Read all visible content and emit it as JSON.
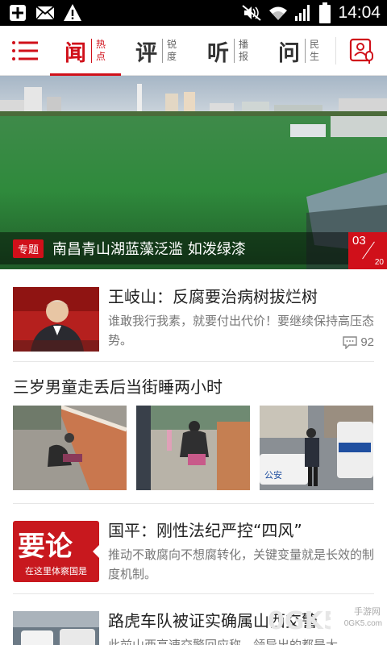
{
  "status_bar": {
    "time": "14:04",
    "left_icons": [
      "add-icon",
      "mail-icon",
      "warning-icon"
    ],
    "right_icons": [
      "mute-icon",
      "wifi-icon",
      "signal-icon",
      "battery-icon"
    ]
  },
  "nav": {
    "tabs": [
      {
        "big": "闻",
        "sub": "热点",
        "active": true
      },
      {
        "big": "评",
        "sub": "锐度",
        "active": false
      },
      {
        "big": "听",
        "sub": "播报",
        "active": false
      },
      {
        "big": "问",
        "sub": "民生",
        "active": false
      }
    ],
    "accent": "#d0101a"
  },
  "hero": {
    "badge": "专题",
    "title": "南昌青山湖蓝藻泛滥 如泼绿漆",
    "page_current": "03",
    "page_total": "20"
  },
  "articles": [
    {
      "title": "王岐山：反腐要治病树拔烂树",
      "summary": "谁敢我行我素，就要付出代价！要继续保持高压态势。",
      "comments": "92"
    },
    {
      "title": "三岁男童走丢后当街睡两小时",
      "photo_caption": "公安"
    },
    {
      "title": "国平：刚性法纪严控“四风”",
      "summary": "推动不敢腐向不想腐转化，关键变量就是长效的制度机制。",
      "logo_big": "要论",
      "logo_small": "在这里体察国是"
    },
    {
      "title": "路虎车队被证实确属山西交警",
      "summary": "此前山西高速交警回应称，领导出的都是大"
    }
  ],
  "watermark": {
    "text": "手游网",
    "sub": "0GK5.com"
  }
}
